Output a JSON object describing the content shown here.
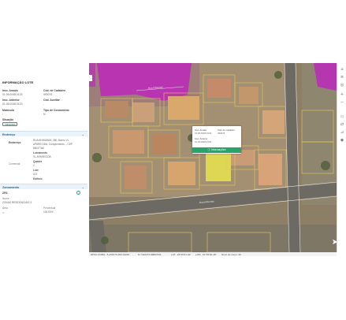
{
  "panel": {
    "title": "INFORMAÇÃO LOTE",
    "insc_anuais_label": "Insc. Anuais",
    "insc_anuais_value": "01.06.0048.0133",
    "cod_cadastro_label": "Cód. de Cadastro",
    "cod_cadastro_value": "490076",
    "insc_anterior_label": "Insc. Anterior",
    "insc_anterior_value": "01.06.0048.0133",
    "cod_auxiliar_label": "Cód. Auxiliar",
    "cod_auxiliar_value": "-",
    "matricula_label": "Matrícula",
    "matricula_value": "-",
    "tipo_condominio_label": "Tipo de Condominio",
    "tipo_condominio_value": "N",
    "situacao_label": "Situação",
    "situacao_value": "Integrado"
  },
  "endereco": {
    "header": "Endereço",
    "rua_label": "Endereço",
    "rua_value_line1": "RUA ANHUMAS, 280, Bairro VL",
    "rua_value_line2": "APARECIDA, Complemento -, CEP",
    "rua_value_line3": "86037340",
    "loteamento_label": "Loteamento",
    "loteamento_value": "VL APARECIDA",
    "comercial_label": "Comercial",
    "quadra_label": "Quadra",
    "quadra_value": "2",
    "lote_label": "Lote",
    "lote_value": "021",
    "edificio_label": "Edifício"
  },
  "zoneamento": {
    "header": "Zoneamento",
    "code": "ZR3",
    "nome_label": "Nome",
    "nome_value": "ZONAS RESIDENCIAIS 3",
    "area_label": "Área",
    "percent_label": "Percentual",
    "percent_value": "100.00%"
  },
  "popup": {
    "insc_label": "Insc. Anuais",
    "insc_value": "01.06.0048.0133",
    "cod_label": "Cód. de Cadastro",
    "cod_value": "490076",
    "insc_ant_label": "Insc. Anterior",
    "insc_ant_value": "01.06.0048.0133",
    "button": "Informações"
  },
  "status": {
    "epsg": "EPSG:31982: -5.490176.000 02240",
    "coords": "N:7420273.88807641",
    "lat": "LAT: -23°25'31.92\"",
    "lon": "LON: -51°35'40.48\"",
    "zoom": "Nível de zoom: 20"
  },
  "map_labels": {
    "street1": "Rua Anhumas",
    "street2": "Rua Anhumas"
  },
  "icons": [
    "home-icon",
    "layers-icon",
    "target-icon",
    "zoom-in-icon",
    "zoom-out-icon",
    "print-icon",
    "share-icon",
    "measure-icon",
    "camera-icon",
    "compass-icon"
  ],
  "colors": {
    "accent": "#2aa36a",
    "section_bg": "#eaf3fa",
    "zone_magenta": "#c21cc4",
    "zone_yellow": "#e8e44d",
    "lot_outline": "#e6c95a"
  }
}
